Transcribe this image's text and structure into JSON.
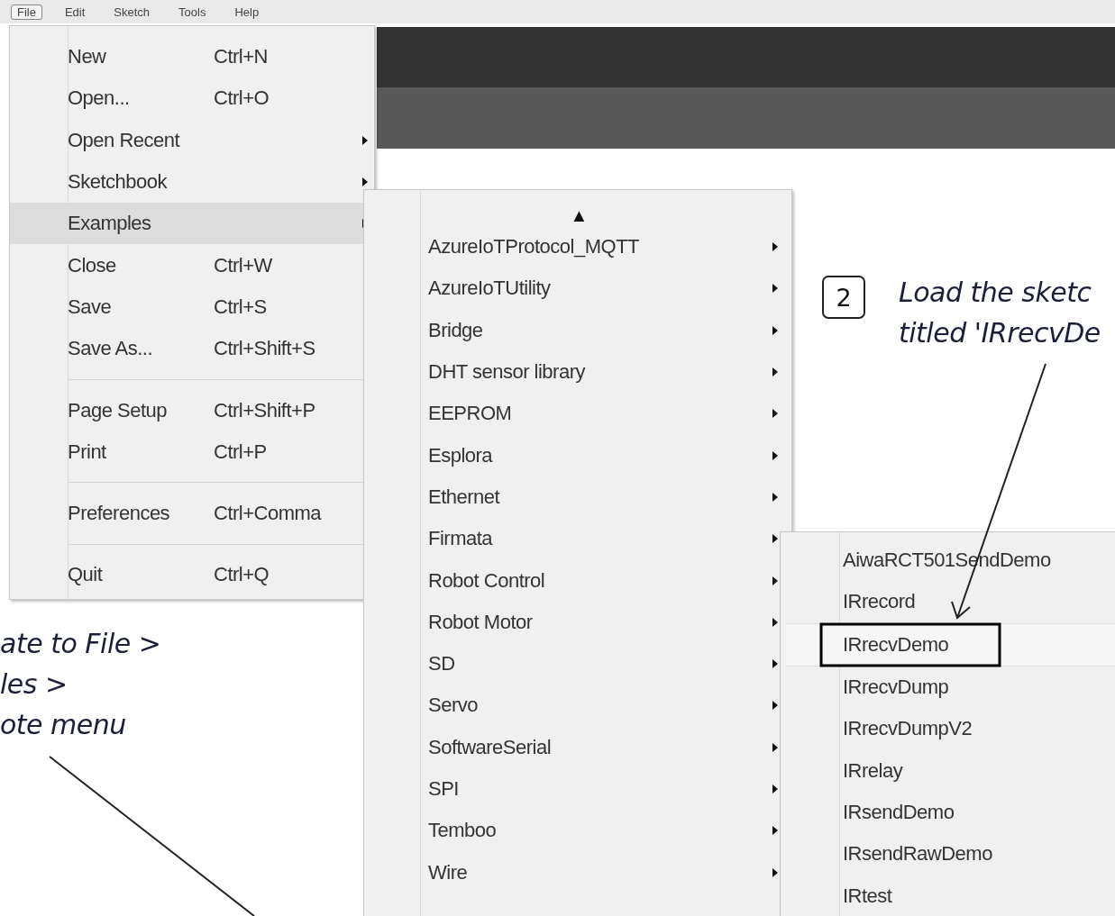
{
  "menubar": [
    {
      "label": "File",
      "selected": true
    },
    {
      "label": "Edit",
      "selected": false
    },
    {
      "label": "Sketch",
      "selected": false
    },
    {
      "label": "Tools",
      "selected": false
    },
    {
      "label": "Help",
      "selected": false
    }
  ],
  "file_menu": [
    {
      "kind": "item",
      "label": "New",
      "shortcut": "Ctrl+N",
      "submenu": false,
      "selected": false
    },
    {
      "kind": "item",
      "label": "Open...",
      "shortcut": "Ctrl+O",
      "submenu": false,
      "selected": false
    },
    {
      "kind": "item",
      "label": "Open Recent",
      "submenu": true,
      "selected": false
    },
    {
      "kind": "item",
      "label": "Sketchbook",
      "submenu": true,
      "selected": false
    },
    {
      "kind": "item",
      "label": "Examples",
      "submenu": true,
      "selected": true
    },
    {
      "kind": "item",
      "label": "Close",
      "shortcut": "Ctrl+W",
      "submenu": false,
      "selected": false
    },
    {
      "kind": "item",
      "label": "Save",
      "shortcut": "Ctrl+S",
      "submenu": false,
      "selected": false
    },
    {
      "kind": "item",
      "label": "Save As...",
      "shortcut": "Ctrl+Shift+S",
      "submenu": false,
      "selected": false
    },
    {
      "kind": "separator"
    },
    {
      "kind": "item",
      "label": "Page Setup",
      "shortcut": "Ctrl+Shift+P",
      "submenu": false,
      "selected": false
    },
    {
      "kind": "item",
      "label": "Print",
      "shortcut": "Ctrl+P",
      "submenu": false,
      "selected": false
    },
    {
      "kind": "separator"
    },
    {
      "kind": "item",
      "label": "Preferences",
      "shortcut": "Ctrl+Comma",
      "submenu": false,
      "selected": false
    },
    {
      "kind": "separator"
    },
    {
      "kind": "item",
      "label": "Quit",
      "shortcut": "Ctrl+Q",
      "submenu": false,
      "selected": false
    }
  ],
  "examples_menu": {
    "scroll_up": "▲",
    "items": [
      {
        "label": "AzureIoTProtocol_MQTT",
        "submenu": true,
        "selected": false
      },
      {
        "label": "AzureIoTUtility",
        "submenu": true,
        "selected": false
      },
      {
        "label": "Bridge",
        "submenu": true,
        "selected": false
      },
      {
        "label": "DHT sensor library",
        "submenu": true,
        "selected": false
      },
      {
        "label": "EEPROM",
        "submenu": true,
        "selected": false
      },
      {
        "label": "Esplora",
        "submenu": true,
        "selected": false
      },
      {
        "label": "Ethernet",
        "submenu": true,
        "selected": false
      },
      {
        "label": "Firmata",
        "submenu": true,
        "selected": false
      },
      {
        "label": "Robot Control",
        "submenu": true,
        "selected": false
      },
      {
        "label": "Robot Motor",
        "submenu": true,
        "selected": false
      },
      {
        "label": "SD",
        "submenu": true,
        "selected": false
      },
      {
        "label": "Servo",
        "submenu": true,
        "selected": false
      },
      {
        "label": "SoftwareSerial",
        "submenu": true,
        "selected": false
      },
      {
        "label": "SPI",
        "submenu": true,
        "selected": false
      },
      {
        "label": "Temboo",
        "submenu": true,
        "selected": false
      },
      {
        "label": "Wire",
        "submenu": true,
        "selected": false
      }
    ]
  },
  "ir_menu": {
    "items": [
      {
        "label": "AiwaRCT501SendDemo",
        "selected": false
      },
      {
        "label": "IRrecord",
        "selected": false
      },
      {
        "label": "IRrecvDemo",
        "selected": true
      },
      {
        "label": "IRrecvDump",
        "selected": false
      },
      {
        "label": "IRrecvDumpV2",
        "selected": false
      },
      {
        "label": "IRrelay",
        "selected": false
      },
      {
        "label": "IRsendDemo",
        "selected": false
      },
      {
        "label": "IRsendRawDemo",
        "selected": false
      },
      {
        "label": "IRtest",
        "selected": false
      }
    ]
  },
  "annotations": [
    {
      "step": "2",
      "lines": [
        "Load the sketc",
        "titled 'IRrecvDe"
      ]
    },
    {
      "lines": [
        "ate to File >",
        "les >",
        "ote menu"
      ]
    }
  ]
}
